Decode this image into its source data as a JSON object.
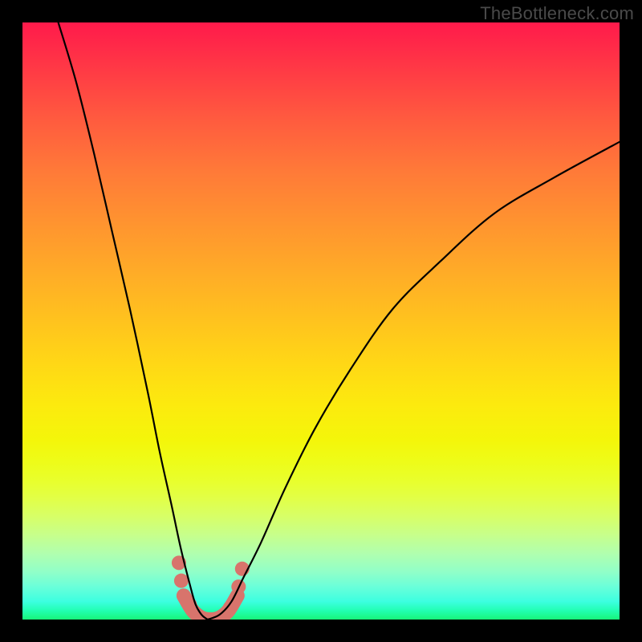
{
  "watermark": "TheBottleneck.com",
  "colors": {
    "frame": "#000000",
    "curve": "#000000",
    "marker": "#d8746c",
    "gradient_top": "#ff1a4b",
    "gradient_bottom": "#18f57a"
  },
  "chart_data": {
    "type": "line",
    "title": "",
    "xlabel": "",
    "ylabel": "",
    "xlim": [
      0,
      100
    ],
    "ylim": [
      0,
      100
    ],
    "notes": "Axes have no tick labels in the source image; x and y are normalized 0–100. Two curves descend from the top edge, meet in a narrow flat valley near x≈31, and diverge; the right curve exits the right edge near y≈80. Salmon-colored markers highlight the valley segment.",
    "series": [
      {
        "name": "left-curve",
        "x": [
          6,
          9,
          12,
          15,
          18,
          21,
          23,
          25,
          26.5,
          28,
          29,
          30,
          31
        ],
        "y": [
          100,
          90,
          78,
          65,
          52,
          38,
          28,
          19,
          12,
          6,
          2.5,
          0.8,
          0
        ]
      },
      {
        "name": "right-curve",
        "x": [
          31,
          33,
          35,
          37,
          40,
          44,
          49,
          55,
          62,
          70,
          79,
          89,
          100
        ],
        "y": [
          0,
          0.8,
          3,
          7,
          13,
          22,
          32,
          42,
          52,
          60,
          68,
          74,
          80
        ]
      }
    ],
    "valley_marker": {
      "x": [
        27,
        28.5,
        30,
        31.5,
        33,
        34.5,
        36
      ],
      "y": [
        4,
        1.5,
        0.3,
        0,
        0.3,
        1.5,
        4
      ]
    },
    "marker_dots": [
      {
        "x": 26.2,
        "y": 9.5
      },
      {
        "x": 26.6,
        "y": 6.5
      },
      {
        "x": 28.0,
        "y": 2.5
      },
      {
        "x": 34.8,
        "y": 2.0
      },
      {
        "x": 36.2,
        "y": 5.5
      },
      {
        "x": 36.8,
        "y": 8.5
      }
    ]
  }
}
